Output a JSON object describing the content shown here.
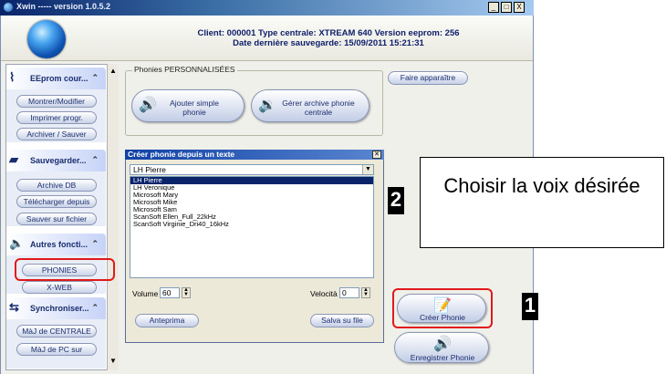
{
  "window": {
    "title": "Xwin ----- version 1.0.5.2",
    "controls": [
      "_",
      "□",
      "X"
    ]
  },
  "header": {
    "line1": "Client: 000001 Type centrale: XTREAM 640 Version eeprom: 256",
    "line2": "Date dernière sauvegarde: 15/09/2011 15:21:31"
  },
  "sidebar": {
    "groups": [
      {
        "label": "EEprom cour...",
        "icon": "chip-icon",
        "items": [
          "Montrer/Modifier",
          "Imprimer progr.",
          "Archiver / Sauver"
        ]
      },
      {
        "label": "Sauvegarder...",
        "icon": "save-icon",
        "items": [
          "Archive DB",
          "Télécharger depuis",
          "Sauver sur fichier"
        ]
      },
      {
        "label": "Autres foncti...",
        "icon": "speaker-icon",
        "items": [
          "PHONIES",
          "X-WEB"
        ]
      },
      {
        "label": "Synchroniser...",
        "icon": "sync-icon",
        "items": [
          "MàJ de CENTRALE",
          "MàJ de PC sur"
        ]
      }
    ]
  },
  "phonies": {
    "legend": "Phonies PERSONNALISÉES",
    "add_label": "Ajouter simple phonie",
    "manage_label": "Gérer archive phonie centrale",
    "show_label": "Faire apparaître"
  },
  "subwindow": {
    "title": "Créer phonie depuis un texte",
    "selected_voice": "LH Pierre",
    "voices": [
      "LH Pierre",
      "LH Veronique",
      "Microsoft Mary",
      "Microsoft Mike",
      "Microsoft Sam",
      "ScanSoft Ellen_Full_22kHz",
      "ScanSoft Virginie_Dri40_16kHz"
    ],
    "volume_label": "Volume",
    "volume_value": "60",
    "velocity_label": "Velocità",
    "velocity_value": "0",
    "preview_label": "Anteprima",
    "save_label": "Salva su file"
  },
  "actions": {
    "create_label": "Créer Phonie",
    "record_label": "Enregistrer Phonie"
  },
  "annotations": {
    "callout_text": "Choisir la voix désirée",
    "badge_1": "1",
    "badge_2": "2",
    "highlight_color": "#e0191b"
  }
}
